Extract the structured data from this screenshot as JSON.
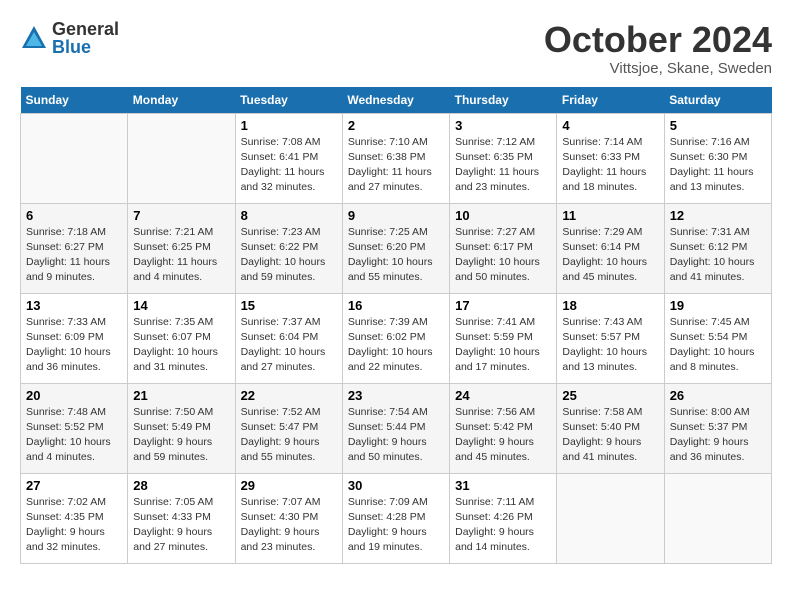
{
  "logo": {
    "general": "General",
    "blue": "Blue"
  },
  "title": {
    "month": "October 2024",
    "location": "Vittsjoe, Skane, Sweden"
  },
  "headers": [
    "Sunday",
    "Monday",
    "Tuesday",
    "Wednesday",
    "Thursday",
    "Friday",
    "Saturday"
  ],
  "weeks": [
    [
      {
        "num": "",
        "info": ""
      },
      {
        "num": "",
        "info": ""
      },
      {
        "num": "1",
        "info": "Sunrise: 7:08 AM\nSunset: 6:41 PM\nDaylight: 11 hours\nand 32 minutes."
      },
      {
        "num": "2",
        "info": "Sunrise: 7:10 AM\nSunset: 6:38 PM\nDaylight: 11 hours\nand 27 minutes."
      },
      {
        "num": "3",
        "info": "Sunrise: 7:12 AM\nSunset: 6:35 PM\nDaylight: 11 hours\nand 23 minutes."
      },
      {
        "num": "4",
        "info": "Sunrise: 7:14 AM\nSunset: 6:33 PM\nDaylight: 11 hours\nand 18 minutes."
      },
      {
        "num": "5",
        "info": "Sunrise: 7:16 AM\nSunset: 6:30 PM\nDaylight: 11 hours\nand 13 minutes."
      }
    ],
    [
      {
        "num": "6",
        "info": "Sunrise: 7:18 AM\nSunset: 6:27 PM\nDaylight: 11 hours\nand 9 minutes."
      },
      {
        "num": "7",
        "info": "Sunrise: 7:21 AM\nSunset: 6:25 PM\nDaylight: 11 hours\nand 4 minutes."
      },
      {
        "num": "8",
        "info": "Sunrise: 7:23 AM\nSunset: 6:22 PM\nDaylight: 10 hours\nand 59 minutes."
      },
      {
        "num": "9",
        "info": "Sunrise: 7:25 AM\nSunset: 6:20 PM\nDaylight: 10 hours\nand 55 minutes."
      },
      {
        "num": "10",
        "info": "Sunrise: 7:27 AM\nSunset: 6:17 PM\nDaylight: 10 hours\nand 50 minutes."
      },
      {
        "num": "11",
        "info": "Sunrise: 7:29 AM\nSunset: 6:14 PM\nDaylight: 10 hours\nand 45 minutes."
      },
      {
        "num": "12",
        "info": "Sunrise: 7:31 AM\nSunset: 6:12 PM\nDaylight: 10 hours\nand 41 minutes."
      }
    ],
    [
      {
        "num": "13",
        "info": "Sunrise: 7:33 AM\nSunset: 6:09 PM\nDaylight: 10 hours\nand 36 minutes."
      },
      {
        "num": "14",
        "info": "Sunrise: 7:35 AM\nSunset: 6:07 PM\nDaylight: 10 hours\nand 31 minutes."
      },
      {
        "num": "15",
        "info": "Sunrise: 7:37 AM\nSunset: 6:04 PM\nDaylight: 10 hours\nand 27 minutes."
      },
      {
        "num": "16",
        "info": "Sunrise: 7:39 AM\nSunset: 6:02 PM\nDaylight: 10 hours\nand 22 minutes."
      },
      {
        "num": "17",
        "info": "Sunrise: 7:41 AM\nSunset: 5:59 PM\nDaylight: 10 hours\nand 17 minutes."
      },
      {
        "num": "18",
        "info": "Sunrise: 7:43 AM\nSunset: 5:57 PM\nDaylight: 10 hours\nand 13 minutes."
      },
      {
        "num": "19",
        "info": "Sunrise: 7:45 AM\nSunset: 5:54 PM\nDaylight: 10 hours\nand 8 minutes."
      }
    ],
    [
      {
        "num": "20",
        "info": "Sunrise: 7:48 AM\nSunset: 5:52 PM\nDaylight: 10 hours\nand 4 minutes."
      },
      {
        "num": "21",
        "info": "Sunrise: 7:50 AM\nSunset: 5:49 PM\nDaylight: 9 hours\nand 59 minutes."
      },
      {
        "num": "22",
        "info": "Sunrise: 7:52 AM\nSunset: 5:47 PM\nDaylight: 9 hours\nand 55 minutes."
      },
      {
        "num": "23",
        "info": "Sunrise: 7:54 AM\nSunset: 5:44 PM\nDaylight: 9 hours\nand 50 minutes."
      },
      {
        "num": "24",
        "info": "Sunrise: 7:56 AM\nSunset: 5:42 PM\nDaylight: 9 hours\nand 45 minutes."
      },
      {
        "num": "25",
        "info": "Sunrise: 7:58 AM\nSunset: 5:40 PM\nDaylight: 9 hours\nand 41 minutes."
      },
      {
        "num": "26",
        "info": "Sunrise: 8:00 AM\nSunset: 5:37 PM\nDaylight: 9 hours\nand 36 minutes."
      }
    ],
    [
      {
        "num": "27",
        "info": "Sunrise: 7:02 AM\nSunset: 4:35 PM\nDaylight: 9 hours\nand 32 minutes."
      },
      {
        "num": "28",
        "info": "Sunrise: 7:05 AM\nSunset: 4:33 PM\nDaylight: 9 hours\nand 27 minutes."
      },
      {
        "num": "29",
        "info": "Sunrise: 7:07 AM\nSunset: 4:30 PM\nDaylight: 9 hours\nand 23 minutes."
      },
      {
        "num": "30",
        "info": "Sunrise: 7:09 AM\nSunset: 4:28 PM\nDaylight: 9 hours\nand 19 minutes."
      },
      {
        "num": "31",
        "info": "Sunrise: 7:11 AM\nSunset: 4:26 PM\nDaylight: 9 hours\nand 14 minutes."
      },
      {
        "num": "",
        "info": ""
      },
      {
        "num": "",
        "info": ""
      }
    ]
  ]
}
